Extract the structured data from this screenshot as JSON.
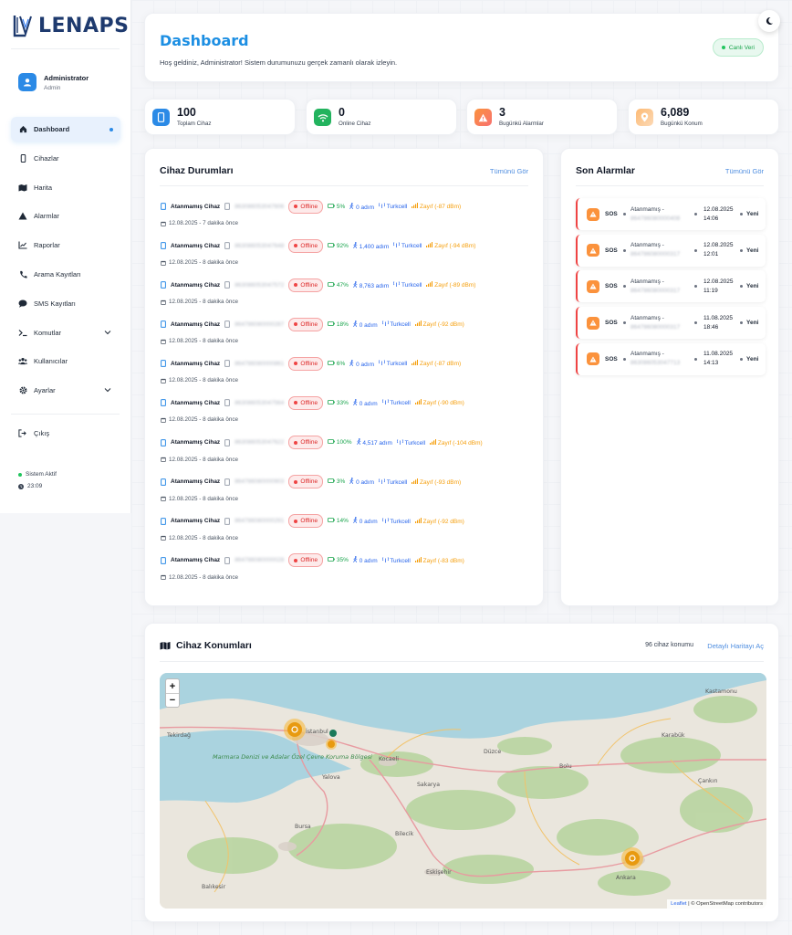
{
  "brand": {
    "name": "LENAPS"
  },
  "user": {
    "name": "Administrator",
    "role": "Admin"
  },
  "nav": [
    {
      "label": "Dashboard",
      "icon": "home-icon",
      "active": true
    },
    {
      "label": "Cihazlar",
      "icon": "phone-icon"
    },
    {
      "label": "Harita",
      "icon": "map-icon"
    },
    {
      "label": "Alarmlar",
      "icon": "warning-icon"
    },
    {
      "label": "Raporlar",
      "icon": "chart-icon"
    },
    {
      "label": "Arama Kayıtları",
      "icon": "call-icon"
    },
    {
      "label": "SMS Kayıtları",
      "icon": "message-icon"
    },
    {
      "label": "Komutlar",
      "icon": "terminal-icon",
      "expandable": true
    },
    {
      "label": "Kullanıcılar",
      "icon": "users-icon"
    },
    {
      "label": "Ayarlar",
      "icon": "gear-icon",
      "expandable": true
    }
  ],
  "logout": "Çıkış",
  "system": {
    "status": "Sistem Aktif",
    "time": "23:09"
  },
  "header": {
    "title": "Dashboard",
    "subtitle": "Hoş geldiniz, Administrator! Sistem durumunuzu gerçek zamanlı olarak izleyin.",
    "live": "Canlı Veri"
  },
  "stats": [
    {
      "value": "100",
      "label": "Toplam Cihaz",
      "color": "#2b8ae6",
      "icon": "device-icon"
    },
    {
      "value": "0",
      "label": "Online Cihaz",
      "color": "#22b35e",
      "icon": "wifi-icon"
    },
    {
      "value": "3",
      "label": "Bugünkü Alarmlar",
      "color": "#f97373",
      "icon": "alert-icon"
    },
    {
      "value": "6,089",
      "label": "Bugünkü Konum",
      "color": "#fbbf8a",
      "icon": "location-icon"
    }
  ],
  "devices": {
    "title": "Cihaz Durumları",
    "view_all": "Tümünü Gör",
    "rows": [
      {
        "name": "Atanmamış Cihaz",
        "imei": "863086053047606",
        "status": "Offline",
        "battery": "5%",
        "steps": "0 adım",
        "operator": "Turkcell",
        "signal": "Zayıf (-87 dBm)",
        "time": "12.08.2025 - 7 dakika önce"
      },
      {
        "name": "Atanmamış Cihaz",
        "imei": "863086053047648",
        "status": "Offline",
        "battery": "92%",
        "steps": "1,400 adım",
        "operator": "Turkcell",
        "signal": "Zayıf (-94 dBm)",
        "time": "12.08.2025 - 8 dakika önce"
      },
      {
        "name": "Atanmamış Cihaz",
        "imei": "863086053047572",
        "status": "Offline",
        "battery": "47%",
        "steps": "8,763 adım",
        "operator": "Turkcell",
        "signal": "Zayıf (-89 dBm)",
        "time": "12.08.2025 - 8 dakika önce"
      },
      {
        "name": "Atanmamış Cihaz",
        "imei": "864786080000287",
        "status": "Offline",
        "battery": "18%",
        "steps": "0 adım",
        "operator": "Turkcell",
        "signal": "Zayıf (-92 dBm)",
        "time": "12.08.2025 - 8 dakika önce"
      },
      {
        "name": "Atanmamış Cihaz",
        "imei": "864786080000861",
        "status": "Offline",
        "battery": "6%",
        "steps": "0 adım",
        "operator": "Turkcell",
        "signal": "Zayıf (-87 dBm)",
        "time": "12.08.2025 - 8 dakika önce"
      },
      {
        "name": "Atanmamış Cihaz",
        "imei": "863086053047564",
        "status": "Offline",
        "battery": "33%",
        "steps": "0 adım",
        "operator": "Turkcell",
        "signal": "Zayıf (-90 dBm)",
        "time": "12.08.2025 - 8 dakika önce"
      },
      {
        "name": "Atanmamış Cihaz",
        "imei": "863086053047622",
        "status": "Offline",
        "battery": "100%",
        "steps": "4,517 adım",
        "operator": "Turkcell",
        "signal": "Zayıf (-104 dBm)",
        "time": "12.08.2025 - 8 dakika önce"
      },
      {
        "name": "Atanmamış Cihaz",
        "imei": "864786080000903",
        "status": "Offline",
        "battery": "3%",
        "steps": "0 adım",
        "operator": "Turkcell",
        "signal": "Zayıf (-93 dBm)",
        "time": "12.08.2025 - 8 dakika önce"
      },
      {
        "name": "Atanmamış Cihaz",
        "imei": "864786080000291",
        "status": "Offline",
        "battery": "14%",
        "steps": "0 adım",
        "operator": "Turkcell",
        "signal": "Zayıf (-92 dBm)",
        "time": "12.08.2025 - 8 dakika önce"
      },
      {
        "name": "Atanmamış Cihaz",
        "imei": "864786080000028",
        "status": "Offline",
        "battery": "35%",
        "steps": "0 adım",
        "operator": "Turkcell",
        "signal": "Zayıf (-83 dBm)",
        "time": "12.08.2025 - 8 dakika önce"
      }
    ]
  },
  "alarms": {
    "title": "Son Alarmlar",
    "view_all": "Tümünü Gör",
    "items": [
      {
        "type": "SOS",
        "who": "Atanmamış -",
        "imei": "864786080000408",
        "date": "12.08.2025",
        "time": "14:06",
        "status": "Yeni"
      },
      {
        "type": "SOS",
        "who": "Atanmamış -",
        "imei": "864786080000317",
        "date": "12.08.2025",
        "time": "12:01",
        "status": "Yeni"
      },
      {
        "type": "SOS",
        "who": "Atanmamış -",
        "imei": "864786080000317",
        "date": "12.08.2025",
        "time": "11:19",
        "status": "Yeni"
      },
      {
        "type": "SOS",
        "who": "Atanmamış -",
        "imei": "864786080000317",
        "date": "11.08.2025",
        "time": "18:46",
        "status": "Yeni"
      },
      {
        "type": "SOS",
        "who": "Atanmamış -",
        "imei": "863086053047713",
        "date": "11.08.2025",
        "time": "14:13",
        "status": "Yeni"
      }
    ]
  },
  "map": {
    "title": "Cihaz Konumları",
    "count": "96 cihaz konumu",
    "detail": "Detaylı Haritayı Aç",
    "zoom_in": "+",
    "zoom_out": "−",
    "attribution_leaflet": "Leaflet",
    "attribution_osm": "| © OpenStreetMap contributors",
    "places": [
      "Tekirdağ",
      "İstanbul",
      "Kocaeli",
      "Yalova",
      "Bursa",
      "Bilecik",
      "Eskişehir",
      "Ankara",
      "Balıkesir",
      "Düzce",
      "Bolu",
      "Karabük",
      "Kastamonu",
      "Çankırı",
      "Sakarya",
      "Marmara Denizi ve Adalar Özel Çevre Koruma Bölgesi"
    ]
  }
}
